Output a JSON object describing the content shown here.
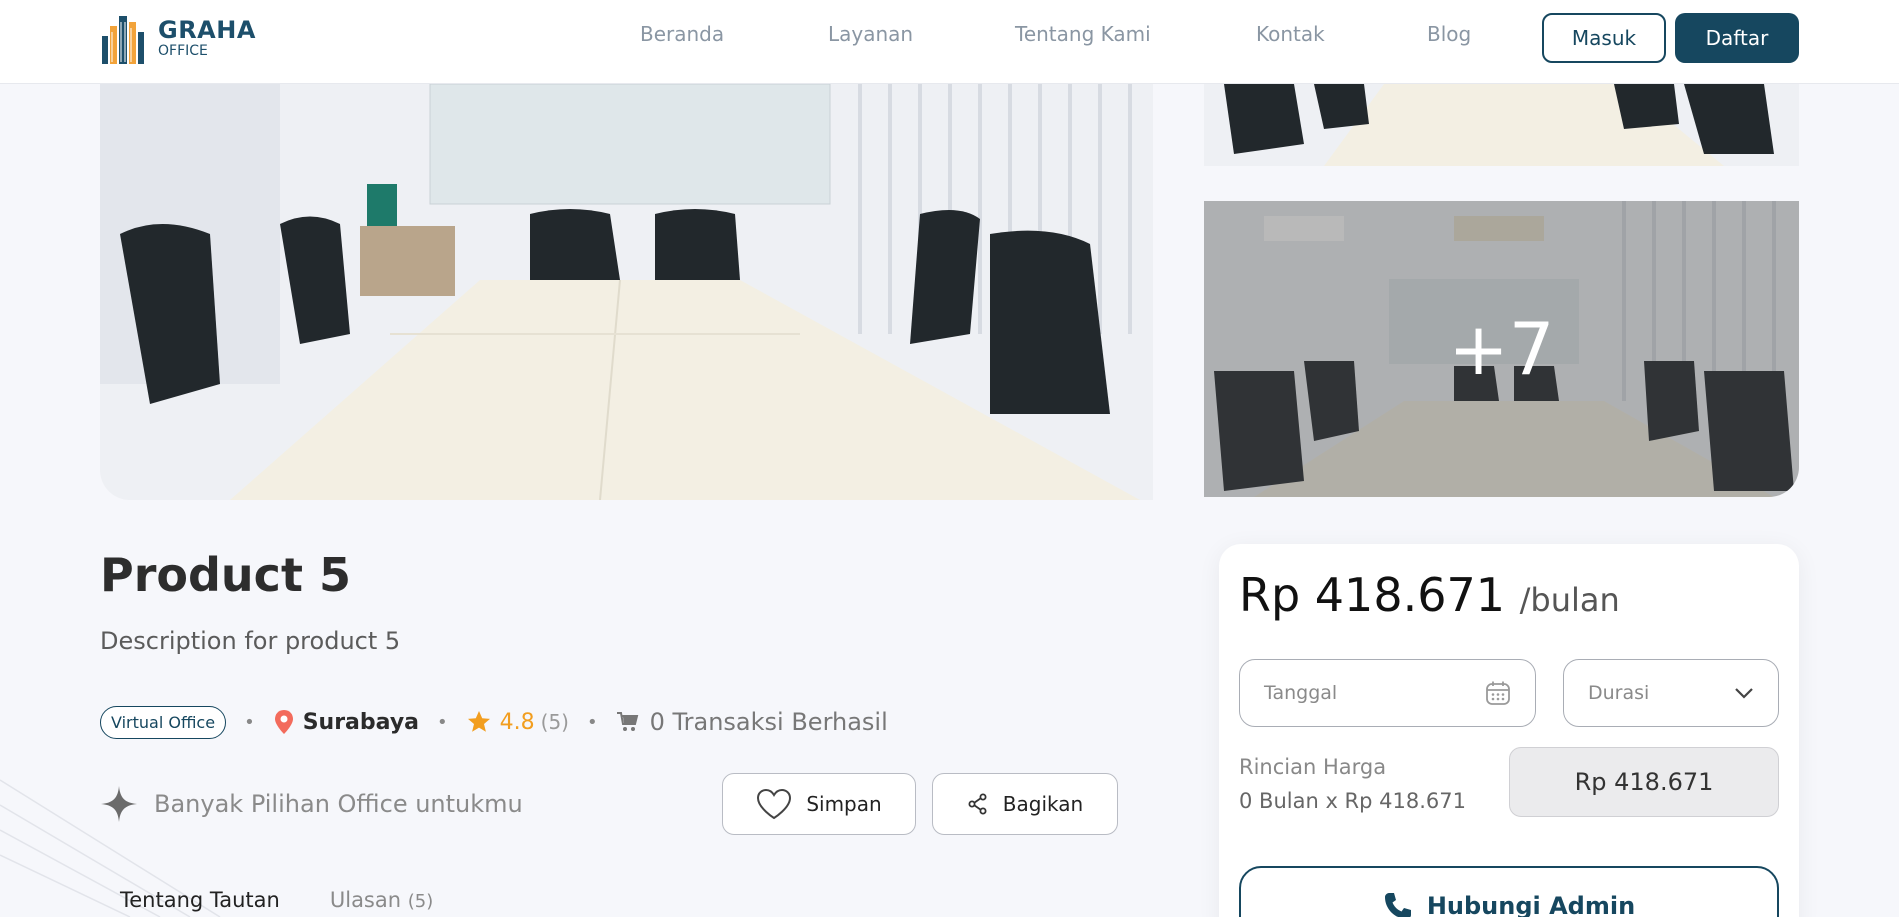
{
  "header": {
    "logo_line1": "GRAHA",
    "logo_line2": "OFFICE",
    "nav": [
      "Beranda",
      "Layanan",
      "Tentang Kami",
      "Kontak",
      "Blog"
    ],
    "login_label": "Masuk",
    "register_label": "Daftar"
  },
  "gallery": {
    "more_count": "+7"
  },
  "product": {
    "title": "Product 5",
    "description": "Description for product 5",
    "category": "Virtual Office",
    "location": "Surabaya",
    "rating": "4.8",
    "rating_count": "(5)",
    "transactions": "0 Transaksi Berhasil",
    "promo": "Banyak Pilihan Office untukmu",
    "save_label": "Simpan",
    "share_label": "Bagikan"
  },
  "tabs": {
    "about": "Tentang Tautan",
    "reviews": "Ulasan",
    "reviews_count": "(5)"
  },
  "pricing": {
    "price": "Rp 418.671",
    "unit": "/bulan",
    "date_placeholder": "Tanggal",
    "duration_placeholder": "Durasi",
    "breakdown_label": "Rincian Harga",
    "breakdown_calc": "0 Bulan x Rp 418.671",
    "total": "Rp 418.671",
    "contact_label": "Hubungi Admin"
  },
  "colors": {
    "brand": "#16475f",
    "rating": "#f29e1f",
    "location_pin": "#f36b5c",
    "background": "#f6f7fb"
  }
}
